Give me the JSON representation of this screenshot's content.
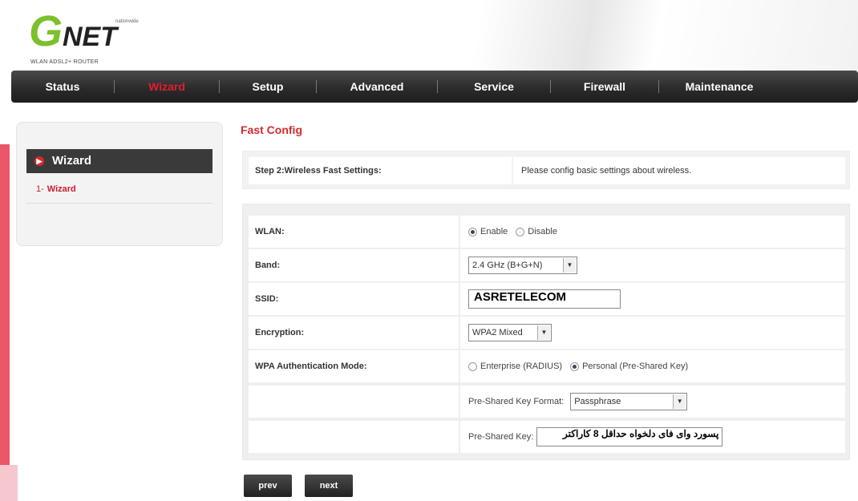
{
  "header": {
    "logo_g": "G",
    "logo_net": "NET",
    "logo_small": "nationwide",
    "logo_sub": "WLAN ADSL2+ ROUTER"
  },
  "nav": {
    "items": [
      "Status",
      "Wizard",
      "Setup",
      "Advanced",
      "Service",
      "Firewall",
      "Maintenance"
    ],
    "active": "Wizard"
  },
  "sidebar": {
    "heading": "Wizard",
    "link": "Wizard",
    "link_prefix": "1-"
  },
  "main": {
    "title": "Fast Config",
    "step_label": "Step 2:Wireless Fast Settings:",
    "step_desc": "Please config basic settings about wireless.",
    "wlan": {
      "label": "WLAN:",
      "opt_enable": "Enable",
      "opt_disable": "Disable",
      "selected": "Enable"
    },
    "band": {
      "label": "Band:",
      "value": "2.4 GHz (B+G+N)"
    },
    "ssid": {
      "label": "SSID:",
      "value": "ASRETELECOM"
    },
    "encryption": {
      "label": "Encryption:",
      "value": "WPA2 Mixed"
    },
    "wpa_mode": {
      "label": "WPA Authentication Mode:",
      "opt_enterprise": "Enterprise (RADIUS)",
      "opt_personal": "Personal (Pre-Shared Key)",
      "selected": "Personal (Pre-Shared Key)"
    },
    "psk_format": {
      "label": "Pre-Shared Key Format:",
      "value": "Passphrase"
    },
    "psk": {
      "label": "Pre-Shared Key:",
      "value": "پسورد وای فای دلخواه حداقل 8 کاراکتر"
    },
    "buttons": {
      "prev": "prev",
      "next": "next"
    }
  }
}
